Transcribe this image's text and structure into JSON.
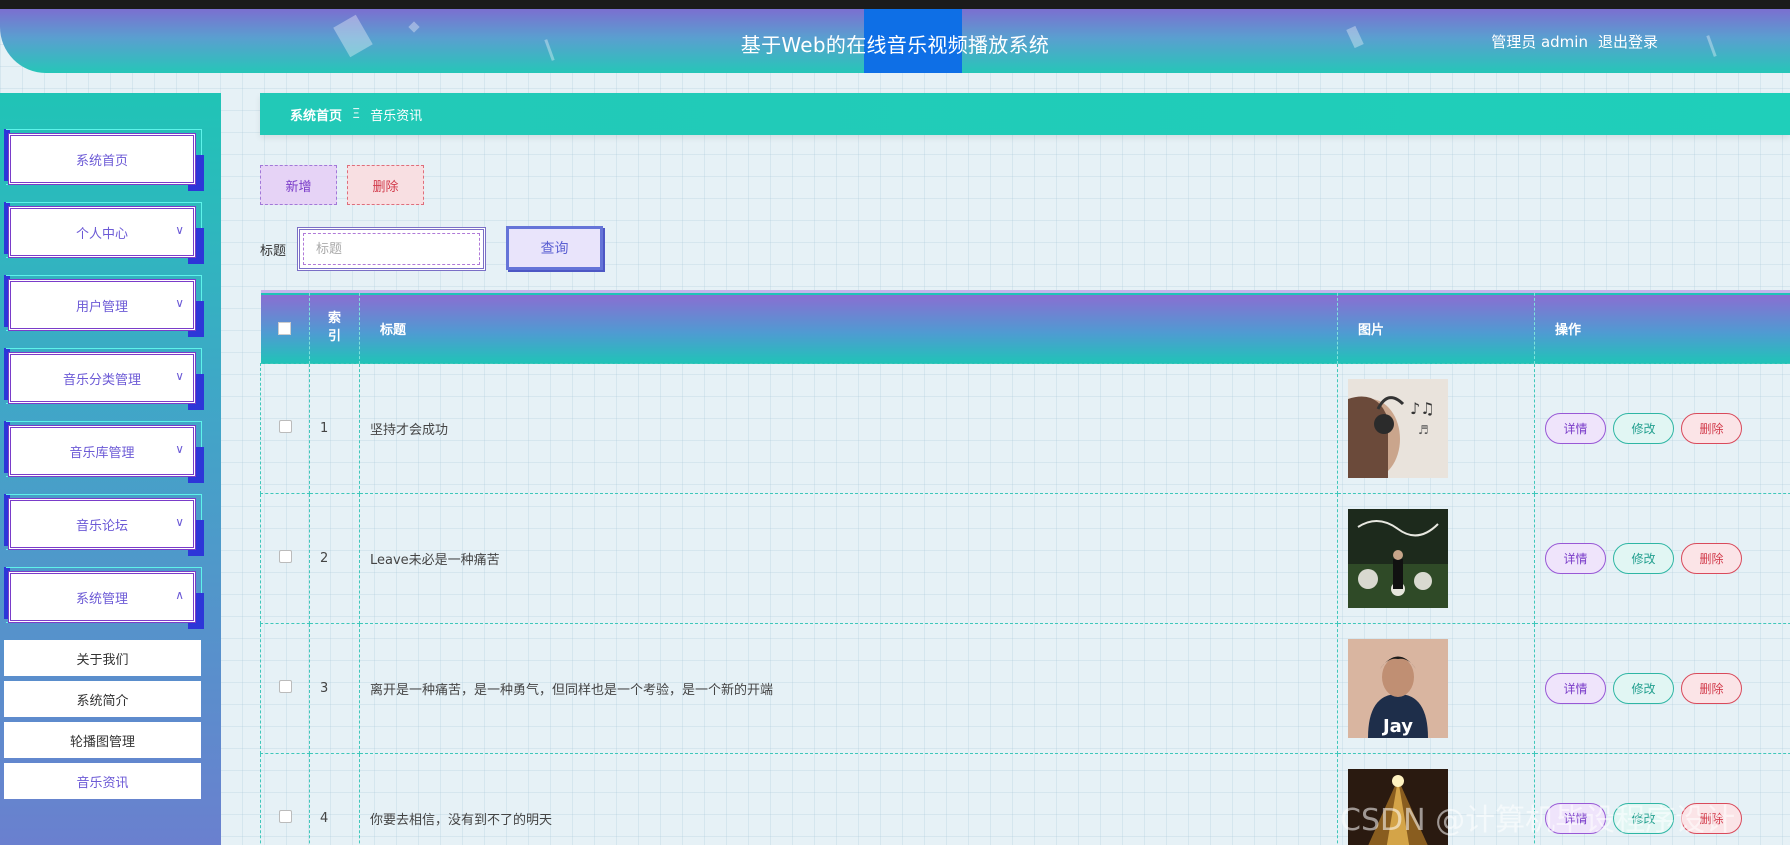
{
  "header": {
    "title": "基于Web的在线音乐视频播放系统",
    "user_label": "管理员 admin",
    "logout_label": "退出登录",
    "highlight_color": "#0e6fe6"
  },
  "sidebar": {
    "menu": [
      {
        "label": "系统首页",
        "has_chevron": false
      },
      {
        "label": "个人中心",
        "chevron": "∨"
      },
      {
        "label": "用户管理",
        "chevron": "∨"
      },
      {
        "label": "音乐分类管理",
        "chevron": "∨"
      },
      {
        "label": "音乐库管理",
        "chevron": "∨"
      },
      {
        "label": "音乐论坛",
        "chevron": "∨"
      },
      {
        "label": "系统管理",
        "chevron": "∧"
      }
    ],
    "submenu": [
      {
        "label": "关于我们"
      },
      {
        "label": "系统简介"
      },
      {
        "label": "轮播图管理"
      },
      {
        "label": "音乐资讯",
        "active": true
      }
    ]
  },
  "breadcrumb": {
    "home": "系统首页",
    "separator": "Ξ",
    "current": "音乐资讯"
  },
  "toolbar": {
    "add_label": "新增",
    "delete_label": "删除",
    "search_label": "标题",
    "search_placeholder": "标题",
    "search_button": "查询"
  },
  "table": {
    "headers": {
      "index": "索\n引",
      "title": "标题",
      "image": "图片",
      "actions": "操作"
    },
    "action_labels": {
      "detail": "详情",
      "edit": "修改",
      "remove": "删除"
    },
    "rows": [
      {
        "index": "1",
        "title": "坚持才会成功",
        "image": "headphones-woman-thumbnail"
      },
      {
        "index": "2",
        "title": "Leave未必是一种痛苦",
        "image": "album-cover-thumbnail"
      },
      {
        "index": "3",
        "title": "离开是一种痛苦，是一种勇气，但同样也是一个考验，是一个新的开端",
        "image": "jay-album-thumbnail",
        "image_text": "Jay"
      },
      {
        "index": "4",
        "title": "你要去相信，没有到不了的明天",
        "image": "concert-thumbnail"
      }
    ]
  },
  "watermark": "CSDN @计算机毕设程序设计",
  "colors": {
    "accent": "#1fc4b7",
    "purple": "#7a3cc9",
    "danger": "#d23b4b"
  }
}
